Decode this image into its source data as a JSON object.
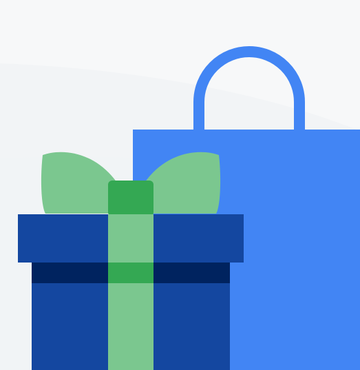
{
  "illustration": {
    "subject": "gift-and-shopping-bag",
    "colors": {
      "background": "#f7f8f9",
      "background_swoosh": "#f2f4f6",
      "shopping_bag": "#4285f4",
      "gift_box_blue": "#1447a0",
      "gift_band_dark": "#00235f",
      "ribbon_light_green": "#7bc78f",
      "ribbon_knot_green": "#34a853"
    },
    "icons": [
      "shopping-bag-icon",
      "gift-box-icon",
      "gift-bow-icon"
    ]
  }
}
